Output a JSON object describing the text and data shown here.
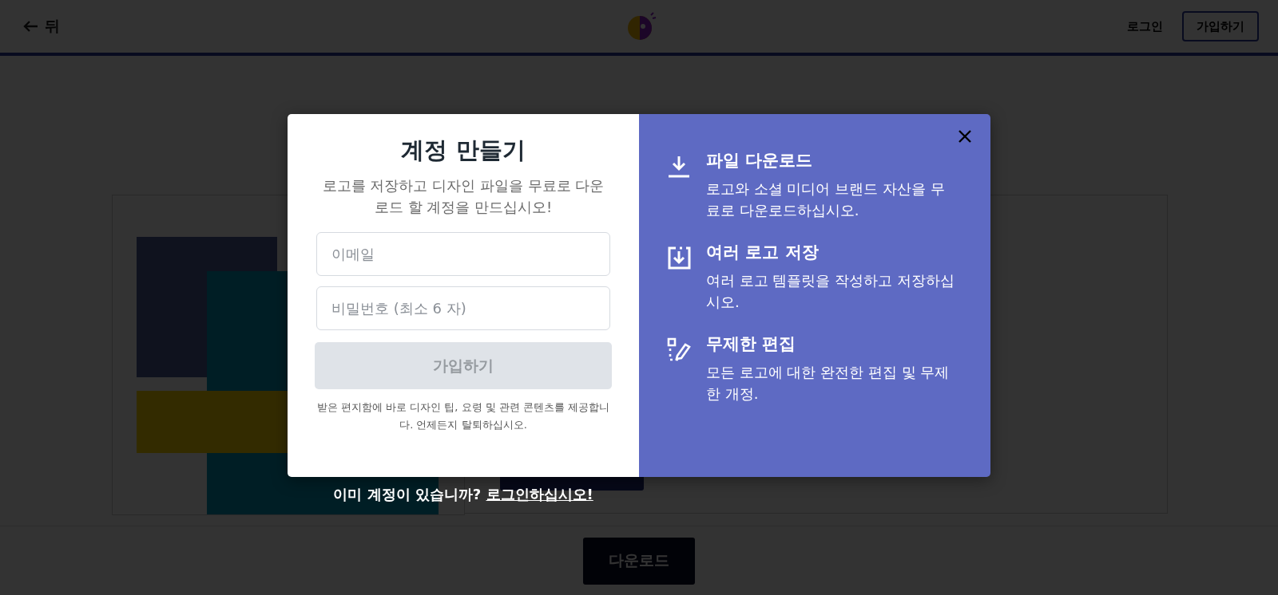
{
  "top_bar": {
    "back_link": "뒤",
    "login_link": "로그인",
    "signup_button": "가입하기"
  },
  "page": {
    "download_button": "다운로드"
  },
  "modal": {
    "title": "계정 만들기",
    "subtitle": "로고를 저장하고 디자인 파일을 무료로 다운로드 할 계정을 만드십시오!",
    "fields": [
      {
        "placeholder": "이메일"
      },
      {
        "placeholder": "비밀번호 (최소 6 자)"
      }
    ],
    "submit_button": {
      "label": "가입하기",
      "disabled": true
    },
    "note": "받은 편지함에 바로 디자인 팁, 요령 및 관련 콘텐츠를 제공합니다. 언제든지 탈퇴하십시오.",
    "features": [
      {
        "kind": "download",
        "title": "파일 다운로드",
        "description": "로고와 소셜 미디어 브랜드 자산을 무료로 다운로드하십시오."
      },
      {
        "kind": "save",
        "title": "여러 로고 저장",
        "description": "여러 로고 템플릿을 작성하고 저장하십시오."
      },
      {
        "kind": "edit",
        "title": "무제한 편집",
        "description": "모든 로고에 대한 완전한 편집 및 무제한 개정."
      }
    ],
    "login_prompt": "이미 계정이 있습니까?",
    "login_link": "로그인하십시오!"
  }
}
